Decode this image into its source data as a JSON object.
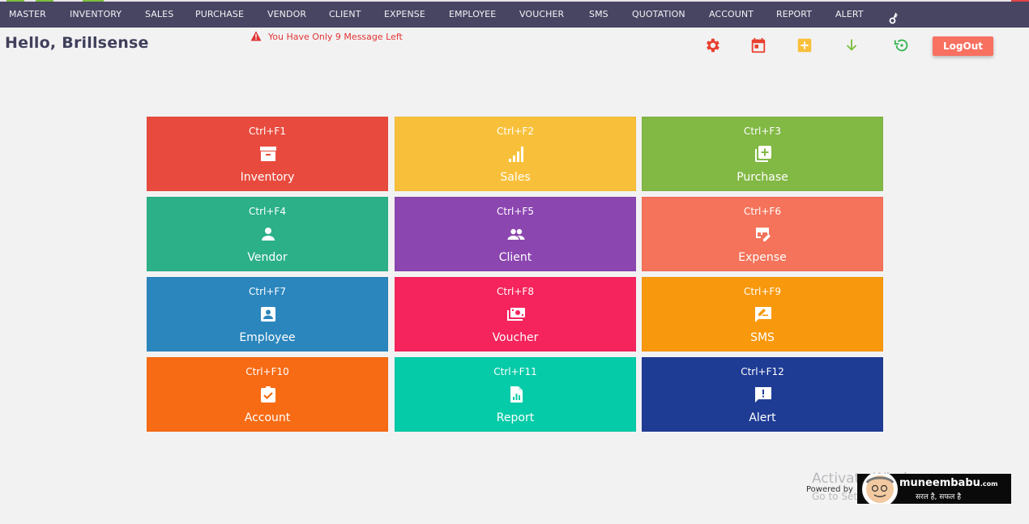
{
  "nav": {
    "items": [
      "MASTER",
      "INVENTORY",
      "SALES",
      "PURCHASE",
      "VENDOR",
      "CLIENT",
      "EXPENSE",
      "EMPLOYEE",
      "VOUCHER",
      "SMS",
      "QUOTATION",
      "ACCOUNT",
      "REPORT",
      "ALERT"
    ]
  },
  "header": {
    "greeting": "Hello,",
    "username": "Brillsense",
    "alert_message": "You Have Only 9 Message Left",
    "logout_label": "LogOut",
    "icons": [
      "settings-icon",
      "calendar-icon",
      "add-box-icon",
      "download-icon",
      "history-icon"
    ]
  },
  "tiles": [
    {
      "shortcut": "Ctrl+F1",
      "label": "Inventory",
      "icon": "archive-icon",
      "color": "#e84b3e"
    },
    {
      "shortcut": "Ctrl+F2",
      "label": "Sales",
      "icon": "signal-bars-icon",
      "color": "#f8c03a"
    },
    {
      "shortcut": "Ctrl+F3",
      "label": "Purchase",
      "icon": "library-add-icon",
      "color": "#82b844"
    },
    {
      "shortcut": "Ctrl+F4",
      "label": "Vendor",
      "icon": "person-icon",
      "color": "#2bb088"
    },
    {
      "shortcut": "Ctrl+F5",
      "label": "Client",
      "icon": "people-icon",
      "color": "#8c46b0"
    },
    {
      "shortcut": "Ctrl+F6",
      "label": "Expense",
      "icon": "table-edit-icon",
      "color": "#f4735a"
    },
    {
      "shortcut": "Ctrl+F7",
      "label": "Employee",
      "icon": "account-box-icon",
      "color": "#2b86bd"
    },
    {
      "shortcut": "Ctrl+F8",
      "label": "Voucher",
      "icon": "money-icon",
      "color": "#f5245c"
    },
    {
      "shortcut": "Ctrl+F9",
      "label": "SMS",
      "icon": "message-edit-icon",
      "color": "#f8980c"
    },
    {
      "shortcut": "Ctrl+F10",
      "label": "Account",
      "icon": "assignment-check-icon",
      "color": "#f76b14"
    },
    {
      "shortcut": "Ctrl+F11",
      "label": "Report",
      "icon": "report-icon",
      "color": "#05cba8"
    },
    {
      "shortcut": "Ctrl+F12",
      "label": "Alert",
      "icon": "feedback-icon",
      "color": "#1f3c95"
    }
  ],
  "footer": {
    "watermark_line1": "Activate Windows",
    "watermark_line2": "Go to Settings to activate Windows.",
    "powered_by": "Powered by",
    "brand_name_1": "muneem",
    "brand_name_2": "babu",
    "brand_domain": ".com",
    "brand_tagline": "सरल है, सफल है"
  },
  "colors": {
    "navbar": "#474562",
    "background": "#f3f2f3",
    "accent_red": "#e03434",
    "logout": "#f87060"
  }
}
